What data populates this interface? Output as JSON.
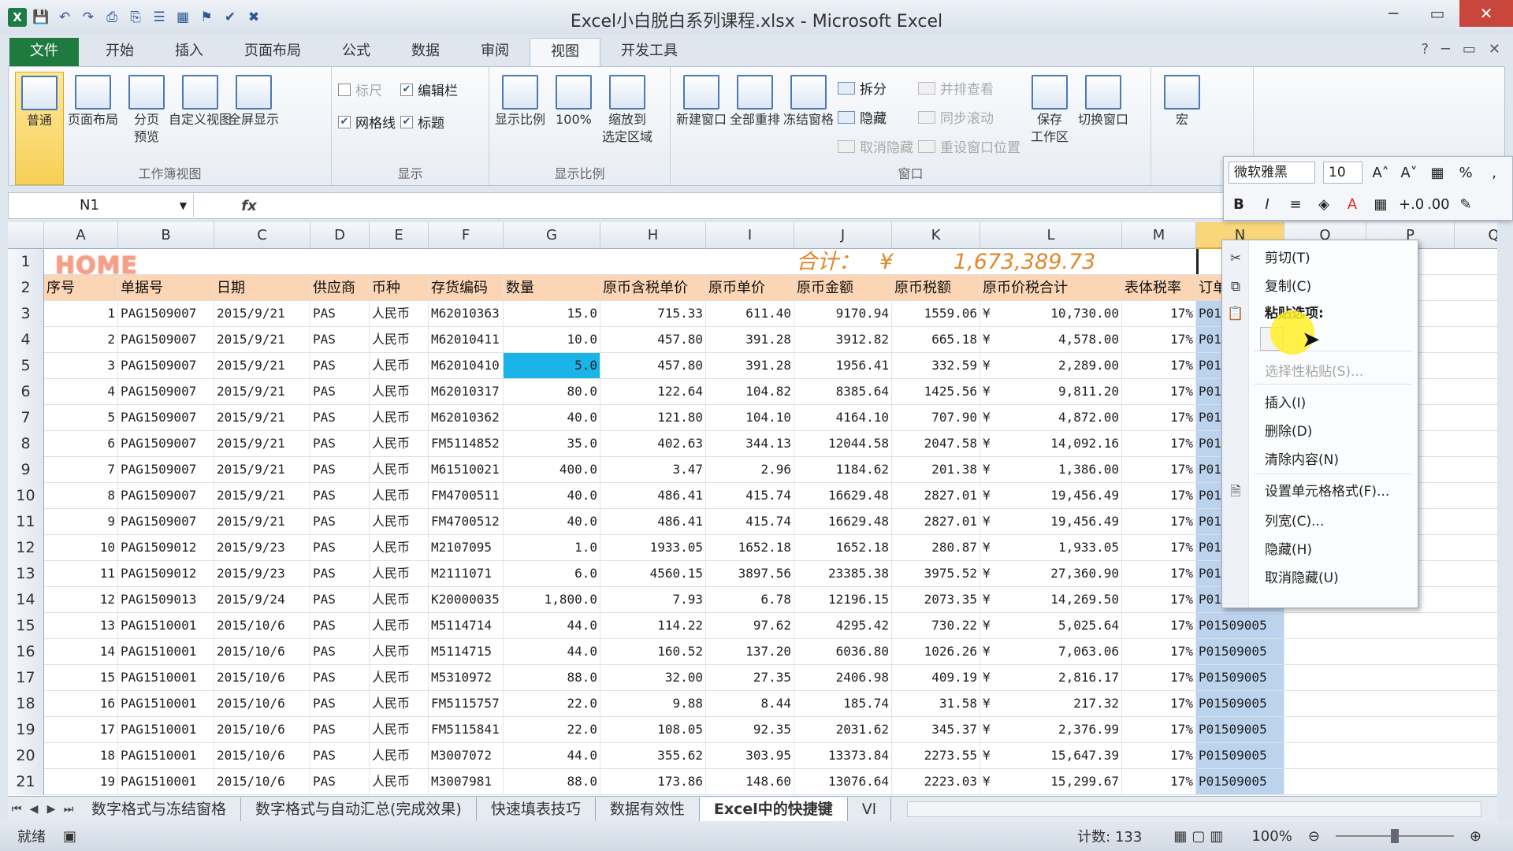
{
  "window": {
    "title": "Excel小白脱白系列课程.xlsx - Microsoft Excel",
    "controls": [
      "─",
      "▭",
      "✕"
    ]
  },
  "qat": [
    "💾",
    "↶",
    "↷",
    "⎙",
    "⎘",
    "☰",
    "▦",
    "⚑",
    "✔",
    "✖"
  ],
  "tabs": [
    "文件",
    "开始",
    "插入",
    "页面布局",
    "公式",
    "数据",
    "审阅",
    "视图",
    "开发工具"
  ],
  "active_tab": "视图",
  "ribbon": {
    "workbook_views": {
      "label": "工作簿视图",
      "buttons": [
        "普通",
        "页面布局",
        "分页\n预览",
        "自定义视图",
        "全屏显示"
      ]
    },
    "show": {
      "label": "显示",
      "checks": [
        {
          "t": "标尺",
          "on": false,
          "dis": true
        },
        {
          "t": "编辑栏",
          "on": true
        },
        {
          "t": "网格线",
          "on": true
        },
        {
          "t": "标题",
          "on": true
        }
      ]
    },
    "zoom": {
      "label": "显示比例",
      "buttons": [
        "显示比例",
        "100%",
        "缩放到\n选定区域"
      ]
    },
    "window": {
      "label": "窗口",
      "buttons": [
        "新建窗口",
        "全部重排",
        "冻结窗格"
      ],
      "small1": [
        "拆分",
        "隐藏",
        "取消隐藏"
      ],
      "small2": [
        "并排查看",
        "同步滚动",
        "重设窗口位置"
      ],
      "buttons2": [
        "保存\n工作区",
        "切换窗口"
      ]
    },
    "macro": {
      "buttons": [
        "宏"
      ]
    }
  },
  "namebox": "N1",
  "fx": "fx",
  "minitoolbar": {
    "font": "微软雅黑",
    "size": "10",
    "row1": [
      "A˄",
      "A˅",
      "▦",
      "%",
      "‚"
    ],
    "row2": [
      "B",
      "I",
      "≡",
      "◈",
      "A",
      "▦",
      "+.0",
      ".00",
      "✎"
    ]
  },
  "columns": [
    "A",
    "B",
    "C",
    "D",
    "E",
    "F",
    "G",
    "H",
    "I",
    "J",
    "K",
    "L",
    "M",
    "N",
    "O",
    "P",
    "Q"
  ],
  "selected_column": "N",
  "row1": {
    "home": "HOME",
    "total_label": "合计：",
    "currency": "¥",
    "total": "1,673,389.73"
  },
  "headers": [
    "序号",
    "单据号",
    "日期",
    "供应商",
    "币种",
    "存货编码",
    "数量",
    "原币含税单价",
    "原币单价",
    "原币金额",
    "原币税额",
    "原币价税合计",
    "表体税率",
    "订单号"
  ],
  "rows": [
    [
      "1",
      "PAG1509007",
      "2015/9/21",
      "PAS",
      "人民币",
      "M62010363",
      "15.0",
      "715.33",
      "611.40",
      "9170.94",
      "1559.06",
      "10,730.00",
      "17%",
      "P0150"
    ],
    [
      "2",
      "PAG1509007",
      "2015/9/21",
      "PAS",
      "人民币",
      "M62010411",
      "10.0",
      "457.80",
      "391.28",
      "3912.82",
      "665.18",
      "4,578.00",
      "17%",
      "P0150"
    ],
    [
      "3",
      "PAG1509007",
      "2015/9/21",
      "PAS",
      "人民币",
      "M62010410",
      "5.0",
      "457.80",
      "391.28",
      "1956.41",
      "332.59",
      "2,289.00",
      "17%",
      "P0150"
    ],
    [
      "4",
      "PAG1509007",
      "2015/9/21",
      "PAS",
      "人民币",
      "M62010317",
      "80.0",
      "122.64",
      "104.82",
      "8385.64",
      "1425.56",
      "9,811.20",
      "17%",
      "P0150"
    ],
    [
      "5",
      "PAG1509007",
      "2015/9/21",
      "PAS",
      "人民币",
      "M62010362",
      "40.0",
      "121.80",
      "104.10",
      "4164.10",
      "707.90",
      "4,872.00",
      "17%",
      "P0150"
    ],
    [
      "6",
      "PAG1509007",
      "2015/9/21",
      "PAS",
      "人民币",
      "FM5114852",
      "35.0",
      "402.63",
      "344.13",
      "12044.58",
      "2047.58",
      "14,092.16",
      "17%",
      "P0150"
    ],
    [
      "7",
      "PAG1509007",
      "2015/9/21",
      "PAS",
      "人民币",
      "M61510021",
      "400.0",
      "3.47",
      "2.96",
      "1184.62",
      "201.38",
      "1,386.00",
      "17%",
      "P0150"
    ],
    [
      "8",
      "PAG1509007",
      "2015/9/21",
      "PAS",
      "人民币",
      "FM4700511",
      "40.0",
      "486.41",
      "415.74",
      "16629.48",
      "2827.01",
      "19,456.49",
      "17%",
      "P0150"
    ],
    [
      "9",
      "PAG1509007",
      "2015/9/21",
      "PAS",
      "人民币",
      "FM4700512",
      "40.0",
      "486.41",
      "415.74",
      "16629.48",
      "2827.01",
      "19,456.49",
      "17%",
      "P0150"
    ],
    [
      "10",
      "PAG1509012",
      "2015/9/23",
      "PAS",
      "人民币",
      "M2107095",
      "1.0",
      "1933.05",
      "1652.18",
      "1652.18",
      "280.87",
      "1,933.05",
      "17%",
      "P0150"
    ],
    [
      "11",
      "PAG1509012",
      "2015/9/23",
      "PAS",
      "人民币",
      "M2111071",
      "6.0",
      "4560.15",
      "3897.56",
      "23385.38",
      "3975.52",
      "27,360.90",
      "17%",
      "P0150"
    ],
    [
      "12",
      "PAG1509013",
      "2015/9/24",
      "PAS",
      "人民币",
      "K20000035",
      "1,800.0",
      "7.93",
      "6.78",
      "12196.15",
      "2073.35",
      "14,269.50",
      "17%",
      "P01509022"
    ],
    [
      "13",
      "PAG1510001",
      "2015/10/6",
      "PAS",
      "人民币",
      "M5114714",
      "44.0",
      "114.22",
      "97.62",
      "4295.42",
      "730.22",
      "5,025.64",
      "17%",
      "P01509005"
    ],
    [
      "14",
      "PAG1510001",
      "2015/10/6",
      "PAS",
      "人民币",
      "M5114715",
      "44.0",
      "160.52",
      "137.20",
      "6036.80",
      "1026.26",
      "7,063.06",
      "17%",
      "P01509005"
    ],
    [
      "15",
      "PAG1510001",
      "2015/10/6",
      "PAS",
      "人民币",
      "M5310972",
      "88.0",
      "32.00",
      "27.35",
      "2406.98",
      "409.19",
      "2,816.17",
      "17%",
      "P01509005"
    ],
    [
      "16",
      "PAG1510001",
      "2015/10/6",
      "PAS",
      "人民币",
      "FM5115757",
      "22.0",
      "9.88",
      "8.44",
      "185.74",
      "31.58",
      "217.32",
      "17%",
      "P01509005"
    ],
    [
      "17",
      "PAG1510001",
      "2015/10/6",
      "PAS",
      "人民币",
      "FM5115841",
      "22.0",
      "108.05",
      "92.35",
      "2031.62",
      "345.37",
      "2,376.99",
      "17%",
      "P01509005"
    ],
    [
      "18",
      "PAG1510001",
      "2015/10/6",
      "PAS",
      "人民币",
      "M3007072",
      "44.0",
      "355.62",
      "303.95",
      "13373.84",
      "2273.55",
      "15,647.39",
      "17%",
      "P01509005"
    ],
    [
      "19",
      "PAG1510001",
      "2015/10/6",
      "PAS",
      "人民币",
      "M3007981",
      "88.0",
      "173.86",
      "148.60",
      "13076.64",
      "2223.03",
      "15,299.67",
      "17%",
      "P01509005"
    ]
  ],
  "context_menu": [
    "剪切(T)",
    "复制(C)",
    "粘贴选项:",
    "选择性粘贴(S)...",
    "插入(I)",
    "删除(D)",
    "清除内容(N)",
    "设置单元格格式(F)...",
    "列宽(C)...",
    "隐藏(H)",
    "取消隐藏(U)"
  ],
  "sheet_tabs": [
    "数字格式与冻结窗格",
    "数字格式与自动汇总(完成效果)",
    "快速填表技巧",
    "数据有效性",
    "Excel中的快捷键",
    "Vl"
  ],
  "active_sheet": "Excel中的快捷键",
  "status": {
    "ready": "就绪",
    "count": "计数: 133",
    "zoom": "100%"
  }
}
